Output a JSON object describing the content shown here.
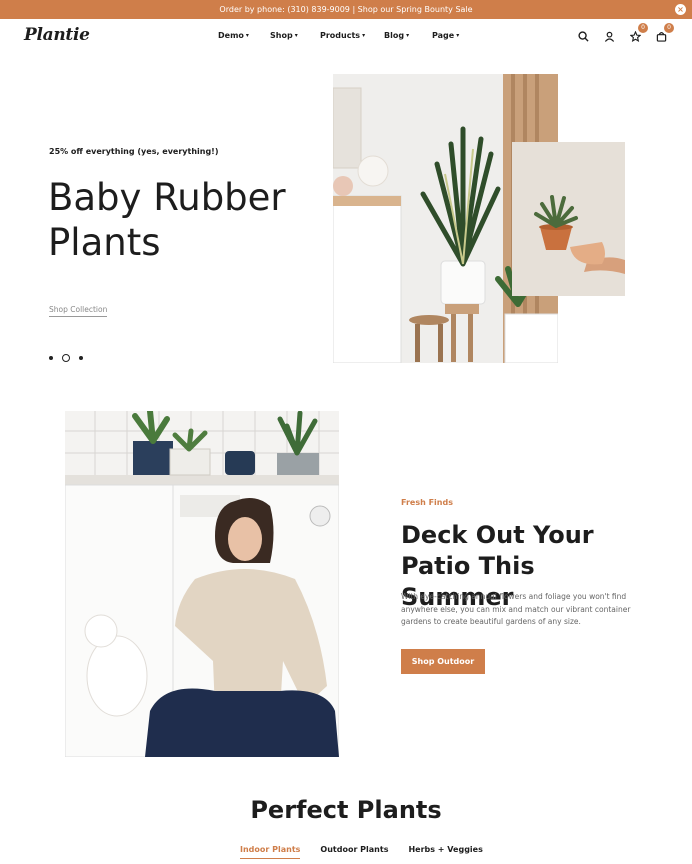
{
  "announcement": {
    "text": "Order by phone: (310) 839-9009 | Shop our Spring Bounty Sale",
    "close_icon": "close-icon"
  },
  "header": {
    "logo": "Plantie",
    "nav": [
      {
        "label": "Demo"
      },
      {
        "label": "Shop"
      },
      {
        "label": "Products"
      },
      {
        "label": "Blog"
      },
      {
        "label": "Page"
      }
    ],
    "icons": [
      "search-icon",
      "user-icon",
      "star-icon",
      "bag-icon"
    ],
    "wishlist_count": "0",
    "cart_count": "0"
  },
  "hero": {
    "subtitle": "25% off everything (yes, everything!)",
    "title_line1": "Baby Rubber",
    "title_line2": "Plants",
    "link": "Shop Collection"
  },
  "promo": {
    "eyebrow": "Fresh Finds",
    "title_line1": "Deck Out Your",
    "title_line2": "Patio This Summer",
    "body": "With eye-catching annual flowers and foliage you won't find anywhere else, you can mix and match our vibrant container gardens to create beautiful gardens of any size.",
    "button": "Shop Outdoor"
  },
  "collection": {
    "title": "Perfect Plants",
    "tabs": [
      {
        "label": "Indoor Plants"
      },
      {
        "label": "Outdoor Plants"
      },
      {
        "label": "Herbs + Veggies"
      }
    ]
  },
  "colors": {
    "accent": "#cf7e4a",
    "text": "#1d1d1d"
  }
}
